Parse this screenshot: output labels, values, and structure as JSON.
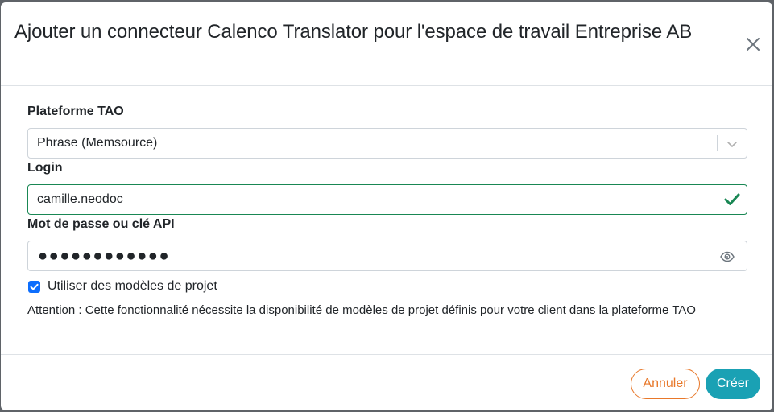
{
  "dialog": {
    "title": "Ajouter un connecteur Calenco Translator pour l'espace de travail Entreprise AB"
  },
  "form": {
    "platform": {
      "label": "Plateforme TAO",
      "selected": "Phrase (Memsource)"
    },
    "login": {
      "label": "Login",
      "value": "camille.neodoc"
    },
    "password": {
      "label": "Mot de passe ou clé API",
      "masked_value": "●●●●●●●●●●●●"
    },
    "use_templates": {
      "label": "Utiliser des modèles de projet",
      "checked": true
    },
    "warning": "Attention : Cette fonctionnalité nécessite la disponibilité de modèles de projet définis pour votre client dans la plateforme TAO"
  },
  "footer": {
    "cancel_label": "Annuler",
    "create_label": "Créer"
  },
  "colors": {
    "cancel": "#e8782a",
    "create": "#1aa1b4",
    "valid": "#198754",
    "checkbox": "#0d6efd"
  }
}
